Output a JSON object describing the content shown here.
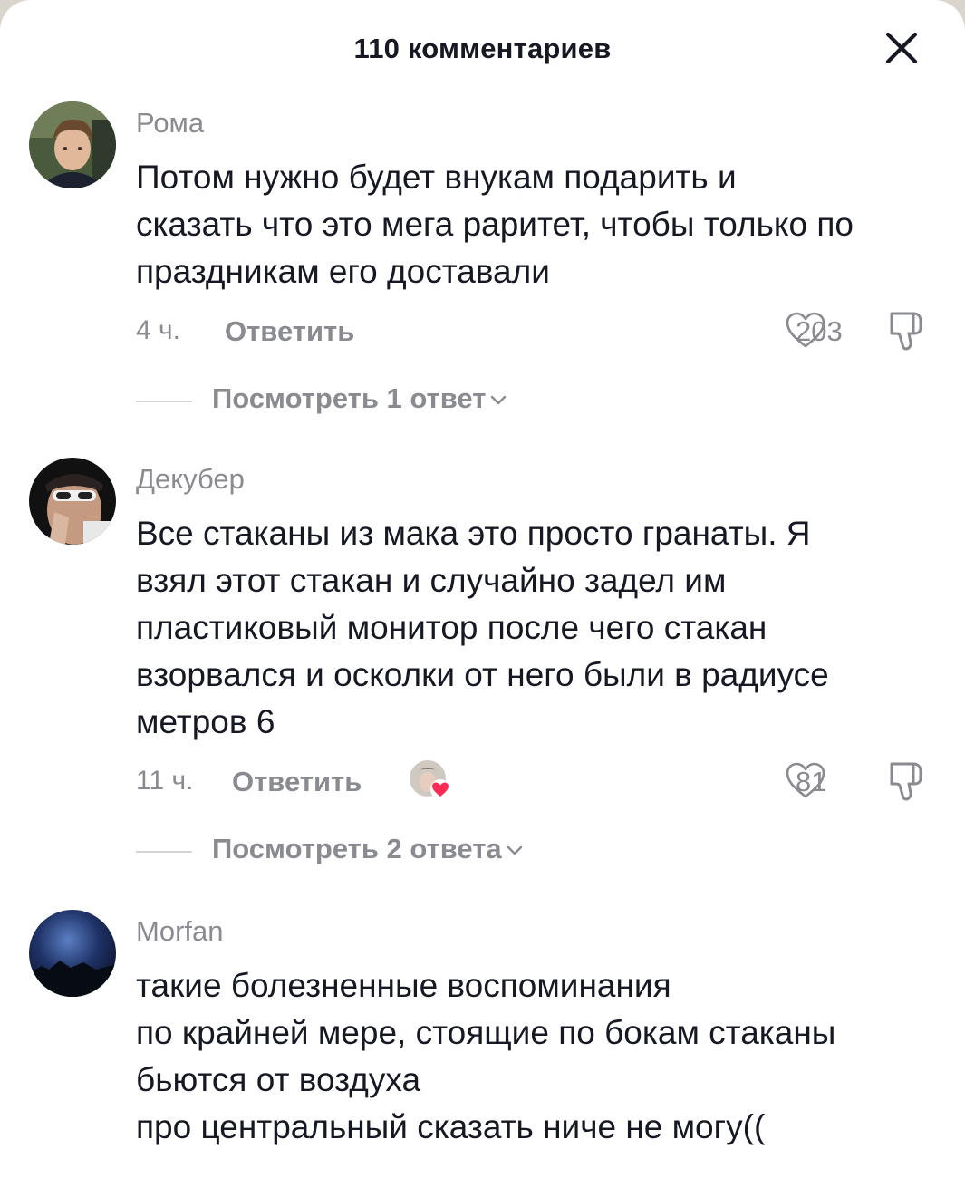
{
  "header": {
    "title": "110 комментариев"
  },
  "comments": [
    {
      "username": "Рома",
      "text": "Потом нужно будет внукам подарить и\nсказать что это мега раритет, чтобы только по\nпраздникам его доставали",
      "time": "4 ч.",
      "reply_label": "Ответить",
      "likes": "203",
      "view_replies": "Посмотреть 1 ответ"
    },
    {
      "username": "Декубер",
      "text": "Все стаканы из мака это просто гранаты. Я\nвзял этот стакан и случайно задел им\nпластиковый монитор после чего стакан\nвзорвался и осколки от него были в радиусе\nметров 6",
      "time": "11 ч.",
      "reply_label": "Ответить",
      "likes": "81",
      "view_replies": "Посмотреть 2 ответа"
    },
    {
      "username": "Morfan",
      "text": "такие болезненные воспоминания\nпо крайней мере, стоящие по бокам стаканы\nбьются от воздуха\nпро центральный сказать ниче не могу(("
    }
  ],
  "colors": {
    "primary_text": "#161823",
    "secondary_text": "#8a8b91",
    "liked_heart": "#fe2c55"
  },
  "icons": [
    "close-icon",
    "heart-outline-icon",
    "dislike-icon",
    "chevron-down-icon",
    "creator-liked-icon"
  ]
}
